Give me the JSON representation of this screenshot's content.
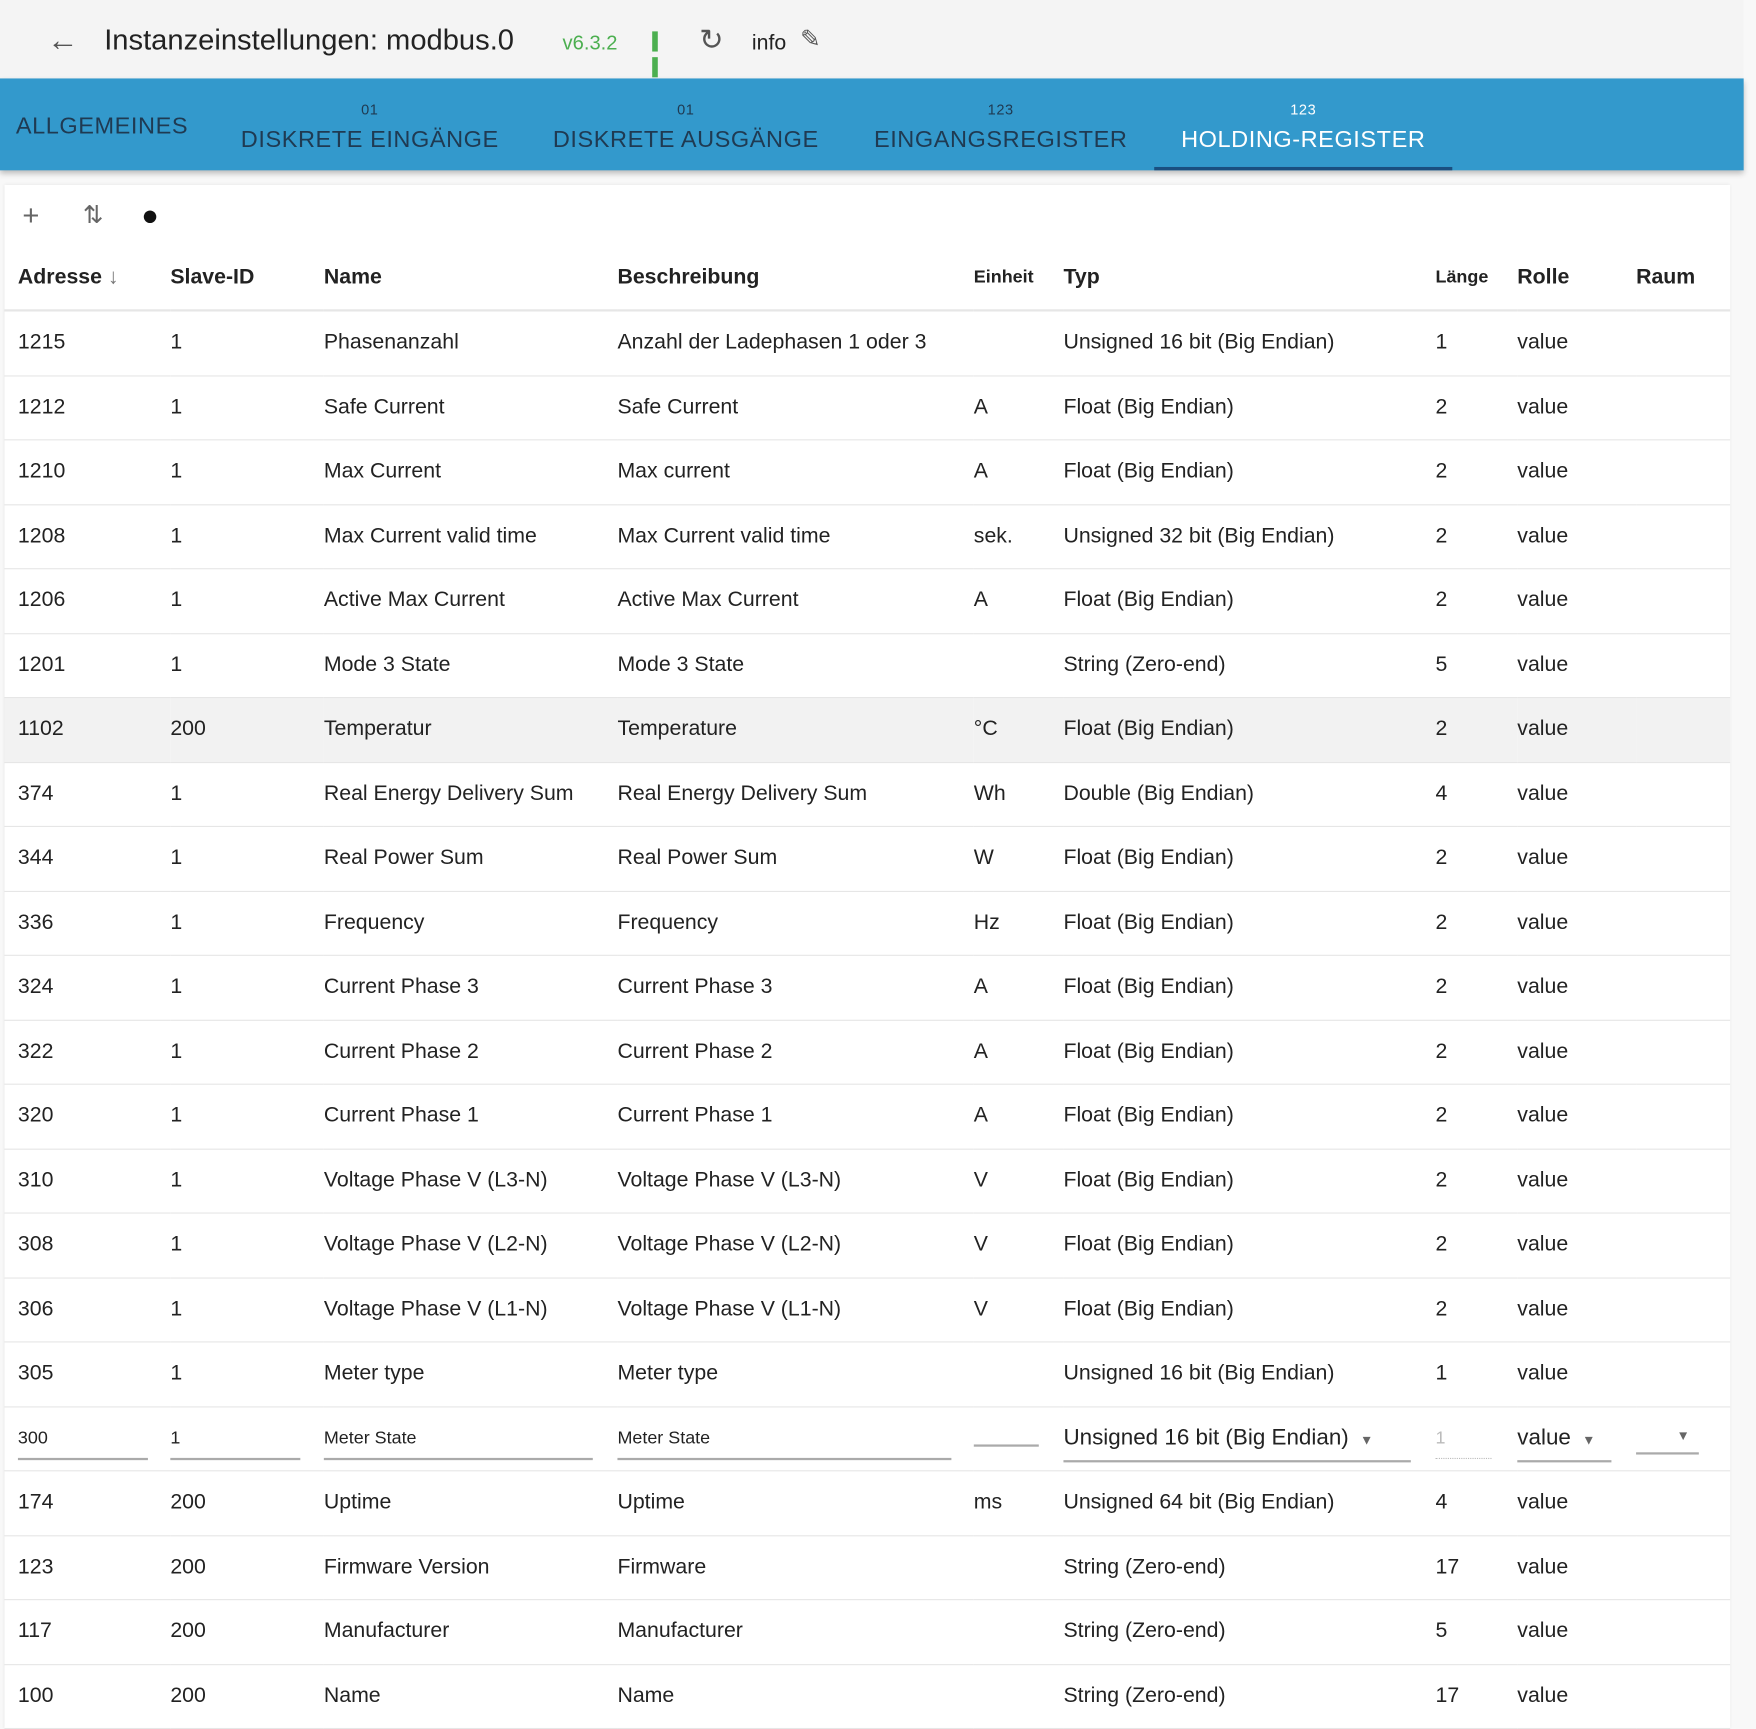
{
  "header": {
    "title": "Instanzeinstellungen: modbus.0",
    "version": "v6.3.2",
    "info": "info"
  },
  "tabs": [
    {
      "badge": "",
      "label": "ALLGEMEINES"
    },
    {
      "badge": "01",
      "label": "DISKRETE EINGÄNGE"
    },
    {
      "badge": "01",
      "label": "DISKRETE AUSGÄNGE"
    },
    {
      "badge": "123",
      "label": "EINGANGSREGISTER"
    },
    {
      "badge": "123",
      "label": "HOLDING-REGISTER"
    }
  ],
  "columns": [
    "Adresse",
    "Slave-ID",
    "Name",
    "Beschreibung",
    "Einheit",
    "Typ",
    "Länge",
    "Rolle",
    "Raum"
  ],
  "rows": [
    [
      "1215",
      "1",
      "Phasenanzahl",
      "Anzahl der Ladephasen 1 oder 3",
      "",
      "Unsigned 16 bit (Big Endian)",
      "1",
      "value"
    ],
    [
      "1212",
      "1",
      "Safe Current",
      "Safe Current",
      "A",
      "Float (Big Endian)",
      "2",
      "value"
    ],
    [
      "1210",
      "1",
      "Max Current",
      "Max current",
      "A",
      "Float (Big Endian)",
      "2",
      "value"
    ],
    [
      "1208",
      "1",
      "Max Current valid time",
      "Max Current valid time",
      "sek.",
      "Unsigned 32 bit (Big Endian)",
      "2",
      "value"
    ],
    [
      "1206",
      "1",
      "Active Max Current",
      "Active Max Current",
      "A",
      "Float (Big Endian)",
      "2",
      "value"
    ],
    [
      "1201",
      "1",
      "Mode 3 State",
      "Mode 3 State",
      "",
      "String (Zero-end)",
      "5",
      "value"
    ],
    [
      "1102",
      "200",
      "Temperatur",
      "Temperature",
      "°C",
      "Float (Big Endian)",
      "2",
      "value"
    ],
    [
      "374",
      "1",
      "Real Energy Delivery Sum",
      "Real Energy Delivery Sum",
      "Wh",
      "Double (Big Endian)",
      "4",
      "value"
    ],
    [
      "344",
      "1",
      "Real Power Sum",
      "Real Power Sum",
      "W",
      "Float (Big Endian)",
      "2",
      "value"
    ],
    [
      "336",
      "1",
      "Frequency",
      "Frequency",
      "Hz",
      "Float (Big Endian)",
      "2",
      "value"
    ],
    [
      "324",
      "1",
      "Current Phase 3",
      "Current Phase 3",
      "A",
      "Float (Big Endian)",
      "2",
      "value"
    ],
    [
      "322",
      "1",
      "Current Phase 2",
      "Current Phase 2",
      "A",
      "Float (Big Endian)",
      "2",
      "value"
    ],
    [
      "320",
      "1",
      "Current Phase 1",
      "Current Phase 1",
      "A",
      "Float (Big Endian)",
      "2",
      "value"
    ],
    [
      "310",
      "1",
      "Voltage Phase V (L3-N)",
      "Voltage Phase V (L3-N)",
      "V",
      "Float (Big Endian)",
      "2",
      "value"
    ],
    [
      "308",
      "1",
      "Voltage Phase V (L2-N)",
      "Voltage Phase V (L2-N)",
      "V",
      "Float (Big Endian)",
      "2",
      "value"
    ],
    [
      "306",
      "1",
      "Voltage Phase V (L1-N)",
      "Voltage Phase V (L1-N)",
      "V",
      "Float (Big Endian)",
      "2",
      "value"
    ],
    [
      "305",
      "1",
      "Meter type",
      "Meter type",
      "",
      "Unsigned 16 bit (Big Endian)",
      "1",
      "value"
    ]
  ],
  "edit_row": [
    "300",
    "1",
    "Meter State",
    "Meter State",
    "",
    "Unsigned 16 bit (Big Endian)",
    "1",
    "value",
    ""
  ],
  "rows2": [
    [
      "174",
      "200",
      "Uptime",
      "Uptime",
      "ms",
      "Unsigned 64 bit (Big Endian)",
      "4",
      "value"
    ],
    [
      "123",
      "200",
      "Firmware Version",
      "Firmware",
      "",
      "String (Zero-end)",
      "17",
      "value"
    ],
    [
      "117",
      "200",
      "Manufacturer",
      "Manufacturer",
      "",
      "String (Zero-end)",
      "5",
      "value"
    ],
    [
      "100",
      "200",
      "Name",
      "Name",
      "",
      "String (Zero-end)",
      "17",
      "value"
    ]
  ],
  "colors": {
    "accent": "#3399cc",
    "version": "#4caf50"
  }
}
